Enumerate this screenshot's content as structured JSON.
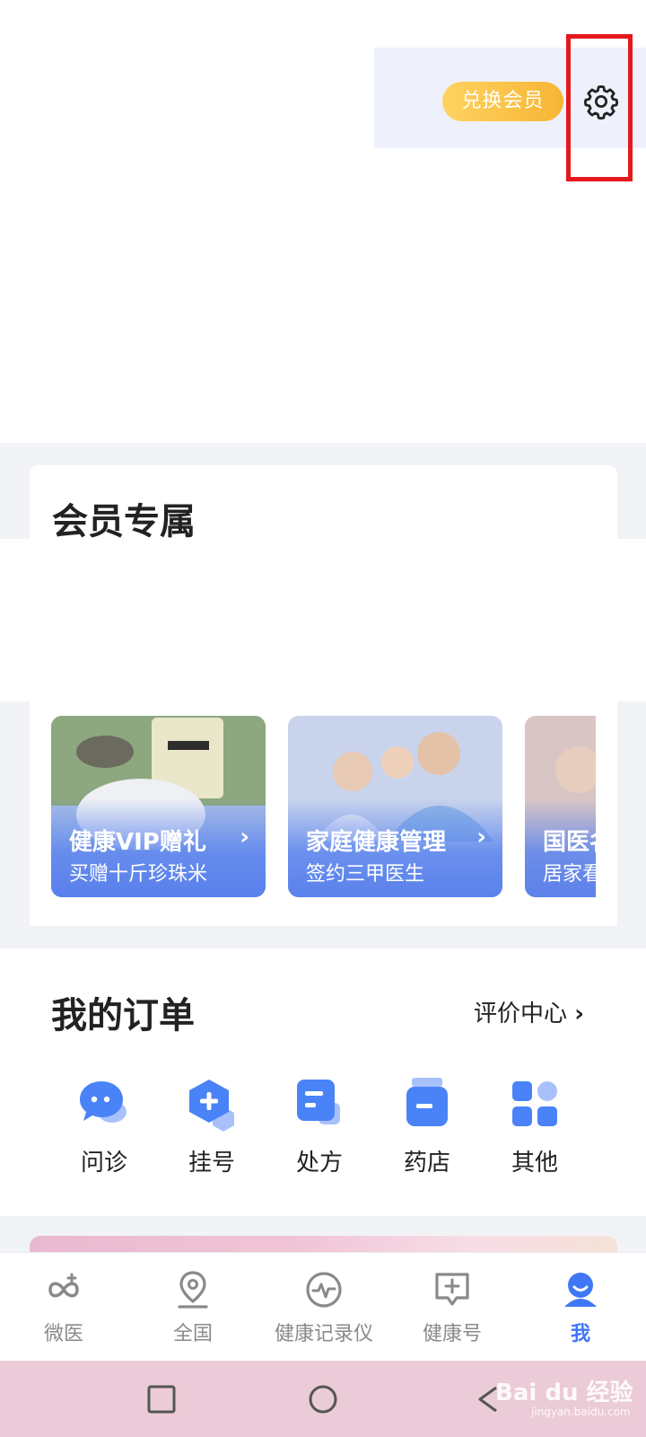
{
  "header": {
    "redeem_button": "兑换会员",
    "settings_icon": "gear-icon"
  },
  "member": {
    "title": "会员专属",
    "banners": [
      {
        "title": "健康VIP赠礼",
        "subtitle": "买赠十斤珍珠米"
      },
      {
        "title": "家庭健康管理",
        "subtitle": "签约三甲医生"
      },
      {
        "title": "国医名",
        "subtitle": "居家看"
      }
    ]
  },
  "orders": {
    "title": "我的订单",
    "review_link": "评价中心",
    "items": [
      {
        "label": "问诊",
        "icon": "chat-bubble-icon"
      },
      {
        "label": "挂号",
        "icon": "hexagon-plus-icon"
      },
      {
        "label": "处方",
        "icon": "prescription-icon"
      },
      {
        "label": "药店",
        "icon": "medicine-bottle-icon"
      },
      {
        "label": "其他",
        "icon": "grid-icon"
      }
    ]
  },
  "bottom_nav": {
    "items": [
      {
        "label": "微医",
        "icon": "weiyi-logo-icon"
      },
      {
        "label": "全国",
        "icon": "location-pin-icon"
      },
      {
        "label": "健康记录仪",
        "icon": "heartbeat-icon"
      },
      {
        "label": "健康号",
        "icon": "message-plus-icon"
      },
      {
        "label": "我",
        "icon": "user-icon",
        "active": true
      }
    ]
  },
  "colors": {
    "accent": "#3f77f6",
    "redeem": "#f7b534",
    "highlight": "#e5181e"
  },
  "watermark": {
    "text": "Bai du 经验",
    "sub": "jingyan.baidu.com"
  }
}
